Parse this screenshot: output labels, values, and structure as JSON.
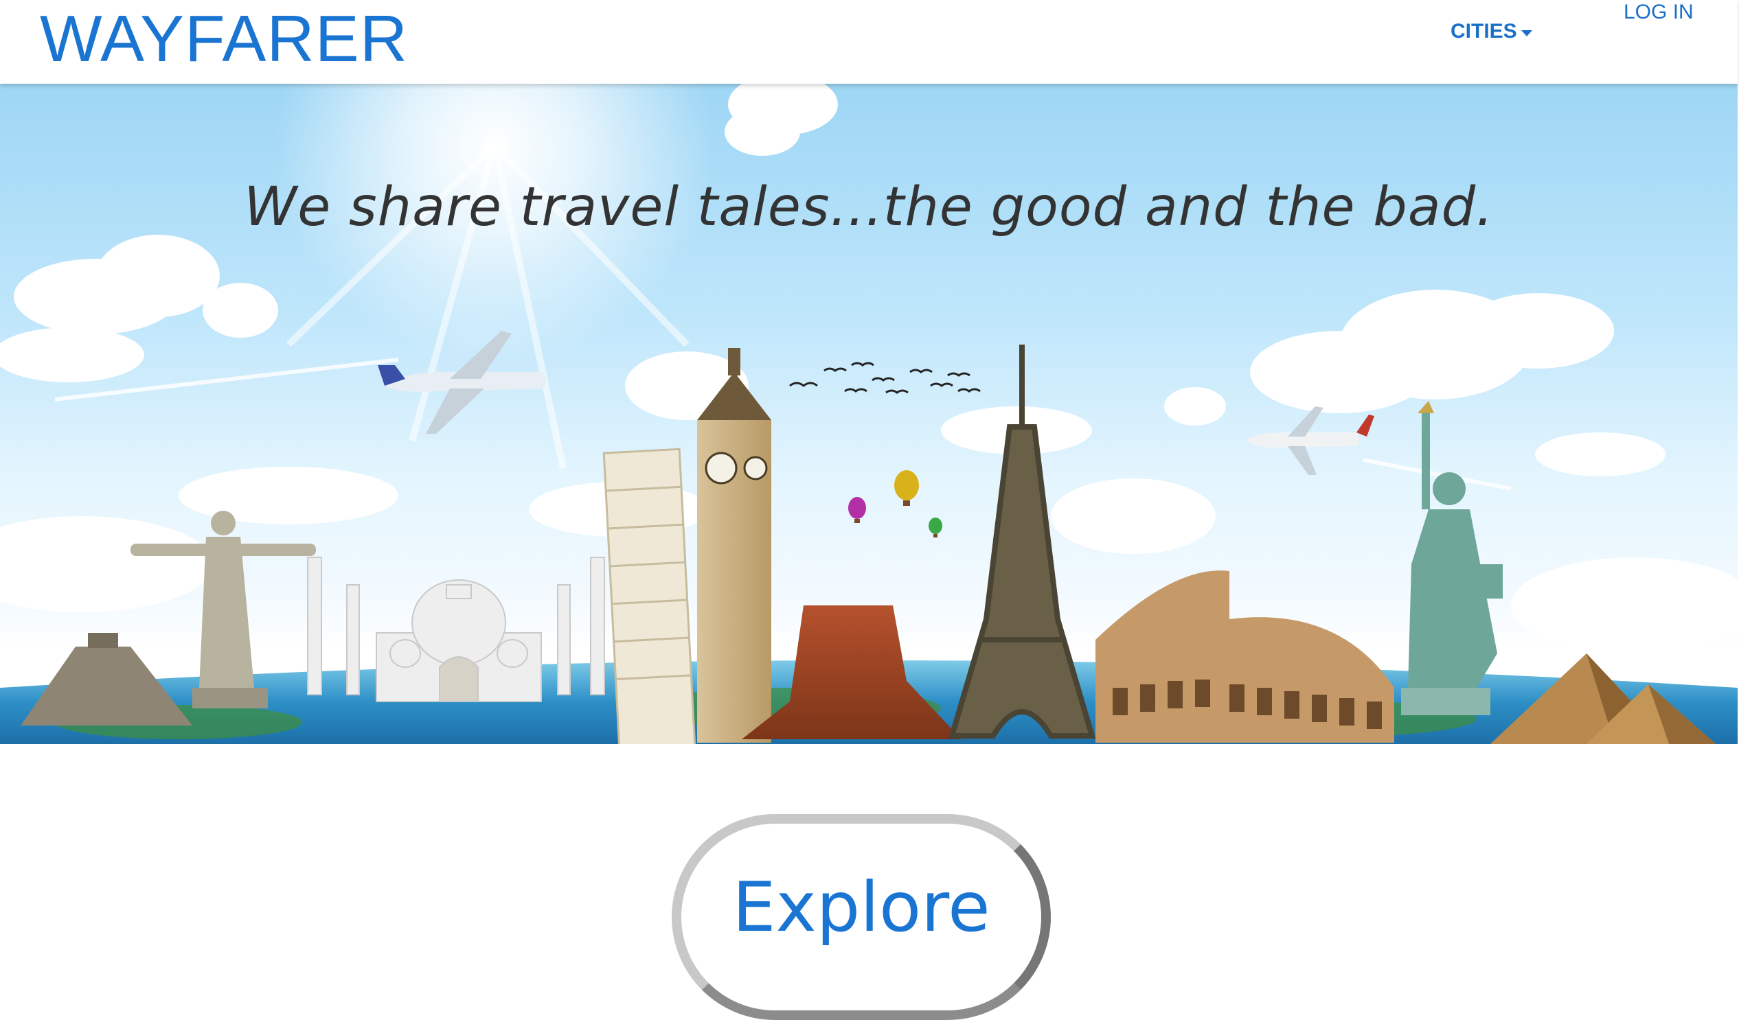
{
  "header": {
    "brand": "WAYFARER",
    "nav": {
      "cities_label": "CITIES",
      "login_label": "LOG IN"
    }
  },
  "hero": {
    "tagline": "We share travel tales...the good and the bad.",
    "landmarks": [
      "chichen-itza-icon",
      "christ-the-redeemer-icon",
      "taj-mahal-icon",
      "leaning-tower-of-pisa-icon",
      "big-ben-icon",
      "monument-valley-icon",
      "eiffel-tower-icon",
      "colosseum-icon",
      "statue-of-liberty-icon",
      "pyramids-icon"
    ]
  },
  "cta": {
    "explore_label": "Explore"
  },
  "colors": {
    "brand_blue": "#1a75d2",
    "nav_blue": "#1a6fc9",
    "sky_top": "#9ed6f5",
    "tagline": "#333333"
  }
}
